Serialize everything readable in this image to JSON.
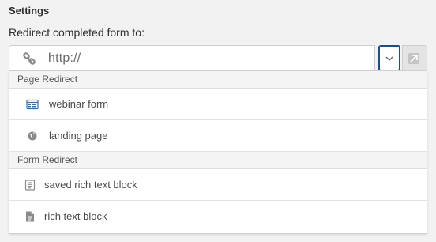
{
  "settings": {
    "title": "Settings",
    "redirect_label": "Redirect completed form to:",
    "url_value": "http://"
  },
  "colors": {
    "focus_border": "#1f4f7a",
    "icon_blue": "#3b6ea5",
    "icon_gray": "#8a8a8a"
  },
  "menu": {
    "groups": [
      {
        "title": "Page Redirect",
        "items": [
          {
            "label": "webinar form",
            "icon": "webinar-form-icon"
          },
          {
            "label": "landing page",
            "icon": "globe-icon"
          }
        ]
      },
      {
        "title": "Form Redirect",
        "items": [
          {
            "label": "saved rich text block",
            "icon": "text-block-icon"
          },
          {
            "label": "rich text block",
            "icon": "document-icon"
          }
        ]
      }
    ]
  }
}
